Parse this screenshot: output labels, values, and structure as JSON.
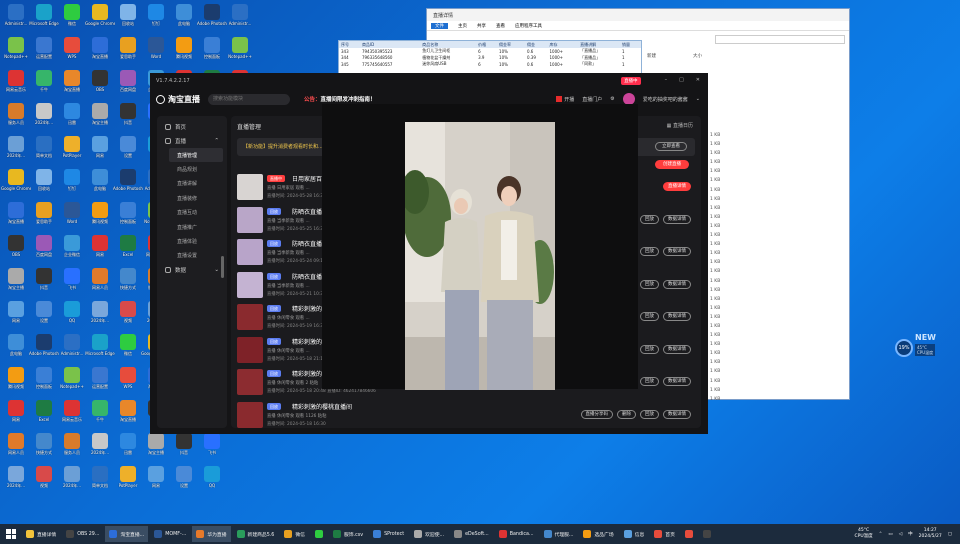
{
  "desktop_icons": [
    {
      "label": "Administr...",
      "color": "#2b6fc4"
    },
    {
      "label": "Notepad++",
      "color": "#7ac24a"
    },
    {
      "label": "网易云音乐",
      "color": "#d33"
    },
    {
      "label": "服务人员",
      "color": "#d87b2a"
    },
    {
      "label": "2024年...",
      "color": "#6b9fd6"
    },
    {
      "label": "Google Chrome",
      "color": "#e8b820"
    },
    {
      "label": "淘宝直播",
      "color": "#2d6dd8"
    },
    {
      "label": "OBS",
      "color": "#333"
    },
    {
      "label": "淘宝主播",
      "color": "#aaa"
    },
    {
      "label": "网易",
      "color": "#5aa0e0"
    },
    {
      "label": "此电脑",
      "color": "#3e8ed8"
    },
    {
      "label": "腾讯视频",
      "color": "#f39c12"
    },
    {
      "label": "网易",
      "color": "#d33"
    },
    {
      "label": "网易人员",
      "color": "#e07a2a"
    },
    {
      "label": "2024年...",
      "color": "#7aa7db"
    },
    {
      "label": "Microsoft Edge",
      "color": "#1aa2c9"
    },
    {
      "label": "运营配置",
      "color": "#3a77d0"
    },
    {
      "label": "千牛",
      "color": "#36b56a"
    },
    {
      "label": "2024年...",
      "color": "#c8c8c8"
    },
    {
      "label": "简单文档",
      "color": "#2a6fc2"
    },
    {
      "label": "回收站",
      "color": "#7fb4e8"
    },
    {
      "label": "爱思助手",
      "color": "#e8a020"
    },
    {
      "label": "百度网盘",
      "color": "#9b59b6"
    },
    {
      "label": "抖音",
      "color": "#333"
    },
    {
      "label": "设置",
      "color": "#4a8ad8"
    },
    {
      "label": "Adobe Photoshop",
      "color": "#1b3c6e"
    },
    {
      "label": "控制面板",
      "color": "#3a7fd6"
    },
    {
      "label": "Excel",
      "color": "#1e7b43"
    },
    {
      "label": "快捷方式",
      "color": "#4488cc"
    },
    {
      "label": "视频",
      "color": "#d84a4a"
    },
    {
      "label": "微信",
      "color": "#2ecc40"
    },
    {
      "label": "WPS",
      "color": "#e74c3c"
    },
    {
      "label": "淘宝直播",
      "color": "#e8872a"
    },
    {
      "label": "迅雷",
      "color": "#2d88e0"
    },
    {
      "label": "PotPlayer",
      "color": "#eeb02a"
    },
    {
      "label": "钉钉",
      "color": "#1e88e5"
    },
    {
      "label": "Word",
      "color": "#2b5797"
    },
    {
      "label": "企业微信",
      "color": "#3a9ad9"
    },
    {
      "label": "飞书",
      "color": "#2970ff"
    },
    {
      "label": "QQ",
      "color": "#1a9cd9"
    }
  ],
  "explorer": {
    "title": "直播详情",
    "ribbon_tabs": [
      "文件",
      "主页",
      "共享",
      "查看",
      "应用程序工具"
    ],
    "side_labels": [
      "新建",
      "大小"
    ],
    "kb_values": [
      "1 KB",
      "1 KB",
      "1 KB",
      "1 KB",
      "1 KB",
      "1 KB",
      "1 KB",
      "1 KB",
      "1 KB",
      "1 KB",
      "1 KB",
      "1 KB",
      "1 KB",
      "1 KB",
      "1 KB",
      "1 KB",
      "1 KB",
      "1 KB",
      "1 KB",
      "1 KB",
      "1 KB",
      "1 KB",
      "1 KB",
      "1 KB",
      "1 KB",
      "1 KB",
      "1 KB",
      "1 KB",
      "1 KB",
      "1 KB"
    ]
  },
  "sheet": {
    "headers": [
      "序号",
      "商品ID",
      "商品名称",
      "价格",
      "佣金率",
      "佣金",
      "库存",
      "直播讲解",
      "销量"
    ],
    "rows": [
      [
        "343",
        "794350395523",
        "鱼灯儿卫生间柜",
        "6",
        "10%",
        "0.6",
        "1000+",
        "「直播品」",
        "1"
      ],
      [
        "344",
        "796335648560",
        "植物花盆干燥剂",
        "3.9",
        "10%",
        "0.39",
        "1000+",
        "「直播品」",
        "1"
      ],
      [
        "345",
        "775745640557",
        "迷你风扇USB",
        "6",
        "10%",
        "0.6",
        "1000+",
        "「同款」",
        "1"
      ]
    ]
  },
  "app": {
    "version": "V1.7.4.2.2.17",
    "live_badge": "直播中",
    "logo_text": "淘宝直播",
    "search_placeholder": "搜索功能模块",
    "notice_prefix": "公告：",
    "notice_text": "直播间限发冲刺指南！",
    "head_status": "开播",
    "head_links": [
      "直播门户"
    ],
    "username": "爱吃的抽奖吧的酱酱",
    "sidebar": {
      "home": "首页",
      "live": "直播",
      "sub_items": [
        "直播管理",
        "商品规划",
        "直播讲解",
        "直播装修",
        "直播互动",
        "直播推广",
        "直播体验",
        "直播设置"
      ],
      "data": "数据"
    },
    "content_title": "直播管理",
    "calendar_label": "直播日历",
    "banner_text": "【新功能】提升消费者观看时长和...",
    "banner_btn": "立即查看",
    "create_btn": "创建直播",
    "rows": [
      {
        "tag": "直播中",
        "tag_red": true,
        "title": "日用家居百货",
        "meta": "直播   日用家居   观看 ...",
        "time": "直播时间: 2024-05-28 16:30",
        "thumb": "#d8d4d2",
        "actions": [
          "直播详情"
        ]
      },
      {
        "tag": "回放",
        "tag_red": false,
        "title": "防晒衣直播",
        "meta": "直播   当季新款   观看 ...",
        "time": "直播时间: 2024-05-25 16:30",
        "thumb": "#b9a6c8",
        "actions": [
          "回放",
          "数据详情"
        ]
      },
      {
        "tag": "回放",
        "tag_red": false,
        "title": "防晒衣直播",
        "meta": "直播   当季新款   观看 ...",
        "time": "直播时间: 2024-05-24 09:10",
        "thumb": "#b8a4c9",
        "actions": [
          "回放",
          "数据详情"
        ]
      },
      {
        "tag": "回放",
        "tag_red": false,
        "title": "防晒衣直播",
        "meta": "直播   当季新款   观看 ...",
        "time": "直播时间: 2024-05-21 10:30",
        "thumb": "#c4b3d2",
        "actions": [
          "回放",
          "数据详情"
        ]
      },
      {
        "tag": "回放",
        "tag_red": false,
        "title": "精彩刺激的",
        "meta": "直播   休闲零食   观看 ...",
        "time": "直播时间: 2024-05-19 16:30",
        "thumb": "#8a2a2e",
        "actions": [
          "回放",
          "数据详情"
        ]
      },
      {
        "tag": "回放",
        "tag_red": false,
        "title": "精彩刺激的",
        "meta": "直播   休闲零食   观看 ...",
        "time": "直播时间: 2024-05-18 21:13",
        "thumb": "#7e2228",
        "actions": [
          "回放",
          "数据详情"
        ]
      },
      {
        "tag": "回放",
        "tag_red": false,
        "title": "精彩刺激的",
        "meta": "直播   休闲零食   观看 2   粘粘",
        "time": "直播时间: 2024-05-18 20:48   直播ID: 462417846606",
        "thumb": "#8c2c30",
        "actions": [
          "直播分享码",
          "删除",
          "回放",
          "数据详情"
        ]
      },
      {
        "tag": "回放",
        "tag_red": false,
        "title": "精彩刺激的樱桃直播间",
        "meta": "直播   休闲零食   观看 1126   粘粘",
        "time": "直播时间: 2024-05-18 16:30",
        "thumb": "#8a2a2e",
        "actions": [
          "直播分享码",
          "删除",
          "回放",
          "数据详情"
        ]
      }
    ]
  },
  "widget": {
    "badge": "NEW",
    "percent": "19%",
    "temp": "45°C",
    "cpu_label": "CPU温度"
  },
  "taskbar": {
    "items": [
      {
        "label": "直播详情",
        "color": "#f2c33b"
      },
      {
        "label": "OBS 29...",
        "color": "#444"
      },
      {
        "label": "淘宝直播...",
        "color": "#2d6dd8",
        "active": true
      },
      {
        "label": "MOMF-...",
        "color": "#2b5797"
      },
      {
        "label": "华为直播",
        "color": "#e87a2a",
        "active": true
      },
      {
        "label": "新建商品5.6",
        "color": "#2a9d5c"
      },
      {
        "label": "微信",
        "color": "#e8a020"
      },
      {
        "label": "",
        "color": "#2ecc40"
      },
      {
        "label": "服饰.csv",
        "color": "#1e7b43"
      },
      {
        "label": "SProtect",
        "color": "#3a7fd6"
      },
      {
        "label": "欢迎使...",
        "color": "#aaa"
      },
      {
        "label": "eDeSoft...",
        "color": "#888"
      },
      {
        "label": "Bandica...",
        "color": "#d33"
      },
      {
        "label": "代理服...",
        "color": "#4488cc"
      },
      {
        "label": "选品广场",
        "color": "#f39c12"
      },
      {
        "label": "信息",
        "color": "#5aa0e0"
      },
      {
        "label": "首页",
        "color": "#e74c3c"
      },
      {
        "label": "",
        "color": "#e74c3c"
      },
      {
        "label": "",
        "color": "#444"
      }
    ],
    "cpu_temp": "45°C",
    "cpu_label": "CPU温度",
    "time": "14:27",
    "date": "2024/5/27"
  }
}
